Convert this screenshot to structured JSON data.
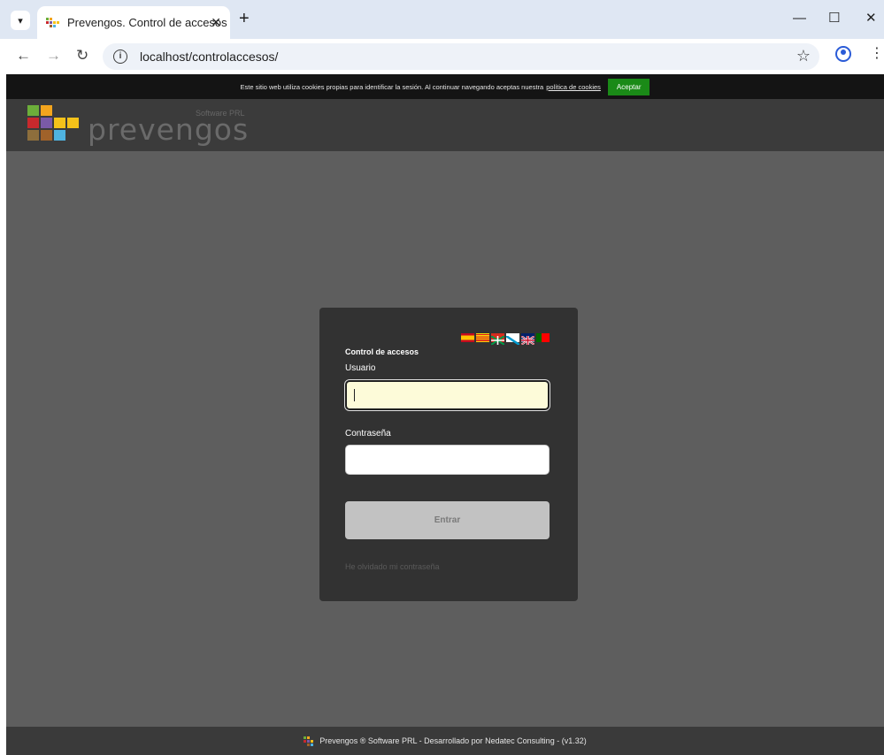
{
  "browser": {
    "tab_title": "Prevengos. Control de accesos",
    "tab_close": "✕",
    "new_tab": "+",
    "url": "localhost/controlaccesos/",
    "window_controls": {
      "minimize": "—",
      "maximize": "☐",
      "close": "✕"
    }
  },
  "cookie_bar": {
    "text": "Este sitio web utiliza cookies propias para identificar la sesión. Al continuar navegando aceptas nuestra",
    "link": "política de cookies",
    "accept": "Aceptar"
  },
  "header": {
    "logo_word": "prevengos",
    "logo_sub": "Software PRL"
  },
  "login": {
    "flags": [
      "es",
      "ca",
      "eu",
      "gl",
      "uk",
      "pt"
    ],
    "title": "Control de accesos",
    "user_label": "Usuario",
    "user_value": "",
    "password_label": "Contraseña",
    "password_value": "",
    "submit": "Entrar",
    "forgot": "He olvidado mi contraseña"
  },
  "footer": {
    "text": "Prevengos ® Software PRL - Desarrollado por Nedatec Consulting - (v1.32)"
  },
  "colors": {
    "page_bg": "#5e5e5e",
    "cookie_bar": "#141414",
    "accept_green": "#1a8a17",
    "card_bg": "#323232",
    "autofill_yellow": "#fdfbd9"
  }
}
